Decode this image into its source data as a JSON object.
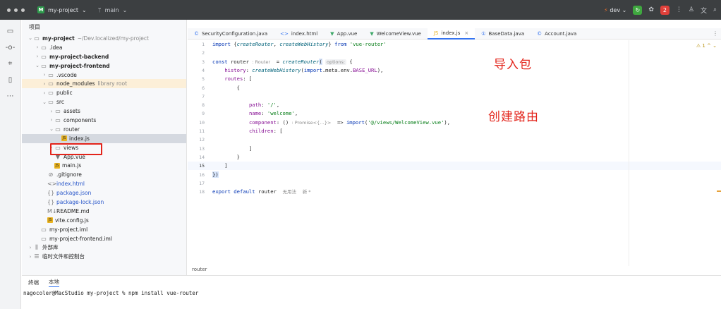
{
  "titlebar": {
    "project_initial": "M",
    "project_name": "my-project",
    "branch": "main",
    "run_config": "dev",
    "run_badge": "2"
  },
  "project_panel": {
    "title": "项目",
    "items": [
      {
        "label": "my-project",
        "extra": "~/Dev.localized/my-project",
        "depth": 0,
        "chev": "⌄",
        "icon": "folder",
        "bold": true
      },
      {
        "label": ".idea",
        "depth": 1,
        "chev": "›",
        "icon": "folder"
      },
      {
        "label": "my-project-backend",
        "depth": 1,
        "chev": "›",
        "icon": "folder",
        "bold": true
      },
      {
        "label": "my-project-frontend",
        "depth": 1,
        "chev": "⌄",
        "icon": "folder",
        "bold": true
      },
      {
        "label": ".vscode",
        "depth": 2,
        "chev": "›",
        "icon": "folder"
      },
      {
        "label": "node_modules",
        "extra": "library root",
        "depth": 2,
        "chev": "›",
        "icon": "folder",
        "excluded": true
      },
      {
        "label": "public",
        "depth": 2,
        "chev": "›",
        "icon": "folder"
      },
      {
        "label": "src",
        "depth": 2,
        "chev": "⌄",
        "icon": "folder"
      },
      {
        "label": "assets",
        "depth": 3,
        "chev": "›",
        "icon": "folder"
      },
      {
        "label": "components",
        "depth": 3,
        "chev": "›",
        "icon": "folder"
      },
      {
        "label": "router",
        "depth": 3,
        "chev": "⌄",
        "icon": "folder"
      },
      {
        "label": "index.js",
        "depth": 4,
        "chev": "",
        "icon": "js",
        "selected": true
      },
      {
        "label": "views",
        "depth": 3,
        "chev": "›",
        "icon": "folder"
      },
      {
        "label": "App.vue",
        "depth": 3,
        "chev": "",
        "icon": "vue"
      },
      {
        "label": "main.js",
        "depth": 3,
        "chev": "",
        "icon": "js"
      },
      {
        "label": ".gitignore",
        "depth": 2,
        "chev": "",
        "icon": "ignore"
      },
      {
        "label": "index.html",
        "depth": 2,
        "chev": "",
        "icon": "html",
        "blue": true
      },
      {
        "label": "package.json",
        "depth": 2,
        "chev": "",
        "icon": "json",
        "blue": true
      },
      {
        "label": "package-lock.json",
        "depth": 2,
        "chev": "",
        "icon": "json",
        "blue": true
      },
      {
        "label": "README.md",
        "depth": 2,
        "chev": "",
        "icon": "md"
      },
      {
        "label": "vite.config.js",
        "depth": 2,
        "chev": "",
        "icon": "js"
      },
      {
        "label": "my-project.iml",
        "depth": 1,
        "chev": "",
        "icon": "iml"
      },
      {
        "label": "my-project-frontend.iml",
        "depth": 1,
        "chev": "",
        "icon": "iml"
      },
      {
        "label": "外部库",
        "depth": 0,
        "chev": "›",
        "icon": "lib"
      },
      {
        "label": "临时文件和控制台",
        "depth": 0,
        "chev": "›",
        "icon": "scratch"
      }
    ]
  },
  "tabs": [
    {
      "label": "SecurityConfiguration.java",
      "icon": "©",
      "color": "#3574f0"
    },
    {
      "label": "index.html",
      "icon": "<>",
      "color": "#3574f0"
    },
    {
      "label": "App.vue",
      "icon": "▼",
      "color": "#3fa86a"
    },
    {
      "label": "WelcomeView.vue",
      "icon": "▼",
      "color": "#3fa86a"
    },
    {
      "label": "index.js",
      "icon": "JS",
      "color": "#e9b21e",
      "active": true
    },
    {
      "label": "BaseData.java",
      "icon": "①",
      "color": "#3574f0"
    },
    {
      "label": "Account.java",
      "icon": "©",
      "color": "#3574f0"
    }
  ],
  "editor": {
    "line_numbers": [
      "1",
      "2",
      "3",
      "4",
      "5",
      "6",
      "7",
      "8",
      "9",
      "10",
      "11",
      "12",
      "13",
      "14",
      "15",
      "16",
      "17",
      "18"
    ],
    "current_line": "15",
    "hint_options": "options:",
    "hint_router": ": Router",
    "hint_promise": ": Promise<{…}>",
    "hint_noinit": "无用法",
    "hint_new": "新 *",
    "annotation_1": "导入包",
    "annotation_2": "创建路由",
    "breadcrumb": "router",
    "warning_count": "⚠ 1  ^  ⌄"
  },
  "terminal": {
    "tab_label": "终端",
    "local_label": "本地",
    "command_line": "nagocoler@MacStudio my-project % npm install vue-router"
  },
  "colors": {
    "accent": "#3574f0",
    "annotation_red": "#e3241b",
    "keyword": "#0033b3",
    "string": "#067d17",
    "property": "#871094"
  }
}
